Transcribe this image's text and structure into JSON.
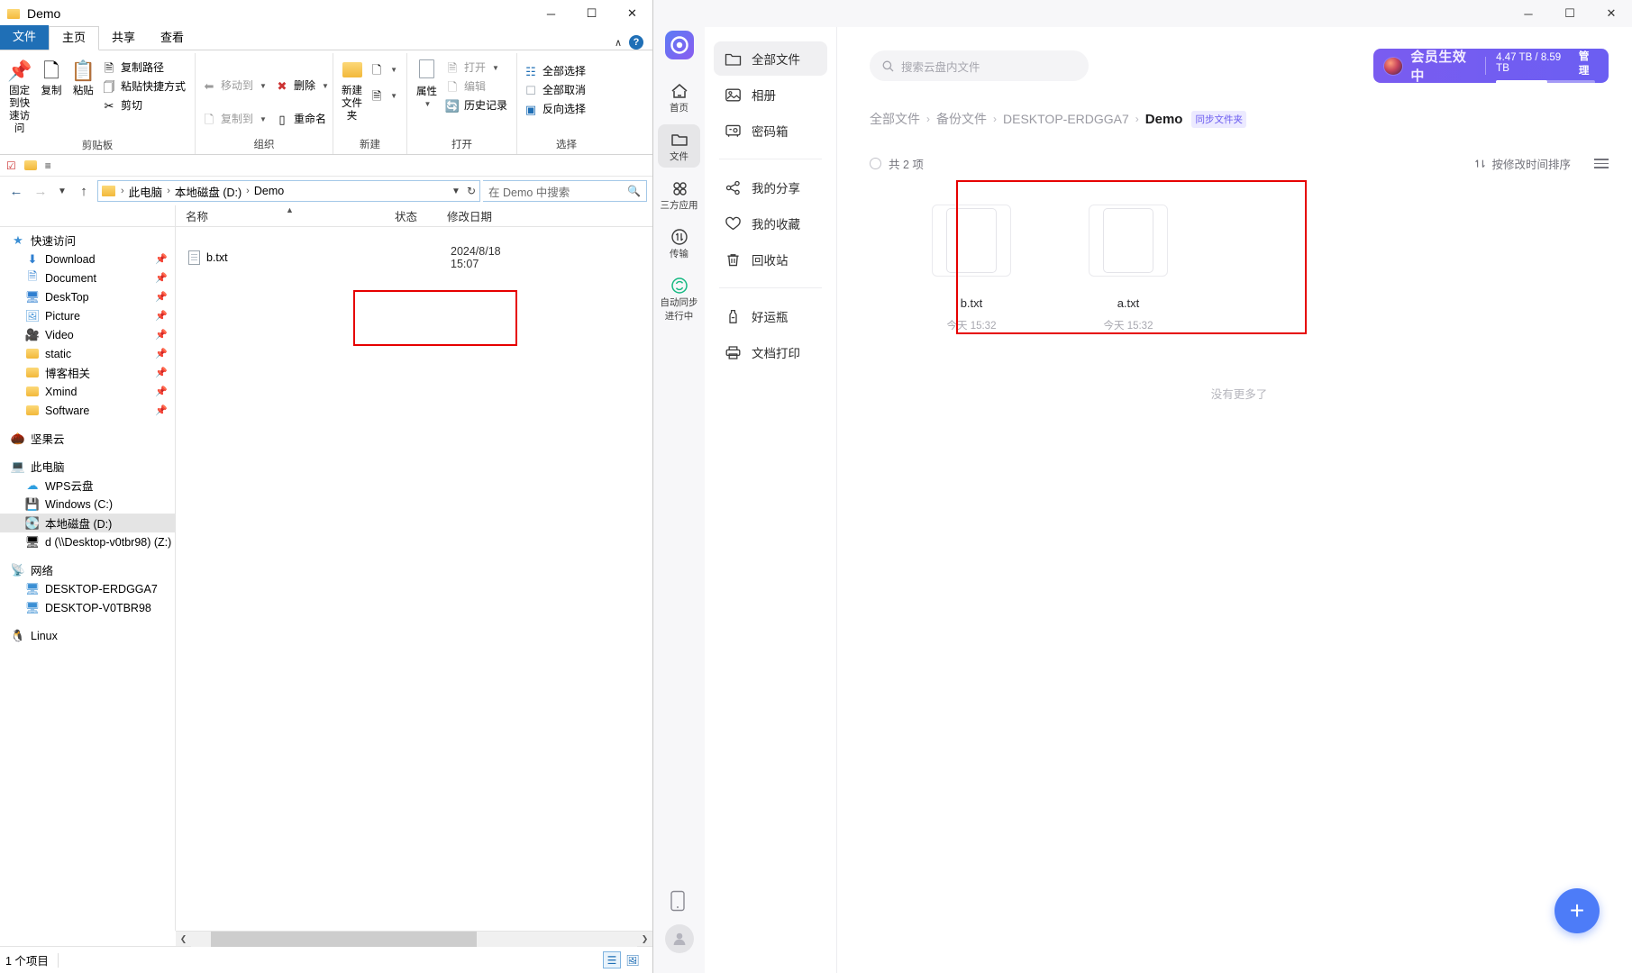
{
  "explorer": {
    "window_title": "Demo",
    "window_controls": {
      "minimize": "─",
      "maximize": "☐",
      "close": "✕"
    },
    "ribbon_tabs": [
      {
        "label": "文件"
      },
      {
        "label": "主页"
      },
      {
        "label": "共享"
      },
      {
        "label": "查看"
      }
    ],
    "ribbon_help": {
      "collapse": "∧",
      "help": "?"
    },
    "ribbon_groups": [
      {
        "label": "剪贴板",
        "big": [
          {
            "label_line1": "固定到快",
            "label_line2": "速访问",
            "icon": "pin-icon"
          },
          {
            "label_line1": "复制",
            "label_line2": "",
            "icon": "copy-icon"
          },
          {
            "label_line1": "粘贴",
            "label_line2": "",
            "icon": "paste-icon"
          }
        ],
        "small": [
          {
            "label": "复制路径",
            "icon": "copy-path-icon",
            "dim": false
          },
          {
            "label": "粘贴快捷方式",
            "icon": "paste-shortcut-icon",
            "dim": false
          },
          {
            "label": "剪切",
            "icon": "scissors-icon",
            "dim": false
          }
        ]
      },
      {
        "label": "组织",
        "small": [
          {
            "label": "移动到",
            "icon": "move-to-icon",
            "dim": true,
            "caret": true
          },
          {
            "label": "复制到",
            "icon": "copy-to-icon",
            "dim": true,
            "caret": true
          },
          {
            "label": "删除",
            "icon": "delete-icon",
            "dim": false,
            "caret": true
          },
          {
            "label": "重命名",
            "icon": "rename-icon",
            "dim": false,
            "caret": false
          }
        ]
      },
      {
        "label": "新建",
        "big": [
          {
            "label_line1": "新建",
            "label_line2": "文件夹",
            "icon": "new-folder-icon"
          }
        ],
        "small": [
          {
            "label": "",
            "icon": "new-item-icon",
            "dim": false,
            "caret": true
          },
          {
            "label": "",
            "icon": "easy-access-icon",
            "dim": false,
            "caret": true
          }
        ]
      },
      {
        "label": "打开",
        "big": [
          {
            "label_line1": "属性",
            "label_line2": "",
            "icon": "properties-icon"
          }
        ],
        "small": [
          {
            "label": "打开",
            "icon": "open-icon",
            "dim": true,
            "caret": true
          },
          {
            "label": "编辑",
            "icon": "edit-icon",
            "dim": true,
            "caret": false
          },
          {
            "label": "历史记录",
            "icon": "history-icon",
            "dim": false,
            "caret": false
          }
        ]
      },
      {
        "label": "选择",
        "small": [
          {
            "label": "全部选择",
            "icon": "select-all-icon",
            "dim": false
          },
          {
            "label": "全部取消",
            "icon": "select-none-icon",
            "dim": false
          },
          {
            "label": "反向选择",
            "icon": "invert-selection-icon",
            "dim": false
          }
        ]
      }
    ],
    "address": {
      "crumbs": [
        "此电脑",
        "本地磁盘 (D:)",
        "Demo"
      ],
      "search_placeholder": "在 Demo 中搜索"
    },
    "columns": [
      {
        "label": "名称"
      },
      {
        "label": "状态"
      },
      {
        "label": "修改日期"
      }
    ],
    "tree": [
      {
        "label": "快速访问",
        "level": 1,
        "icon": "star-icon",
        "pin": false
      },
      {
        "label": "Download",
        "level": 2,
        "icon": "download-icon",
        "pin": true
      },
      {
        "label": "Document",
        "level": 2,
        "icon": "document-icon",
        "pin": true
      },
      {
        "label": "DeskTop",
        "level": 2,
        "icon": "desktop-icon",
        "pin": true
      },
      {
        "label": "Picture",
        "level": 2,
        "icon": "picture-icon",
        "pin": true
      },
      {
        "label": "Video",
        "level": 2,
        "icon": "video-icon",
        "pin": true
      },
      {
        "label": "static",
        "level": 2,
        "icon": "folder-icon",
        "pin": true
      },
      {
        "label": "博客相关",
        "level": 2,
        "icon": "folder-icon",
        "pin": true
      },
      {
        "label": "Xmind",
        "level": 2,
        "icon": "folder-icon",
        "pin": true
      },
      {
        "label": "Software",
        "level": 2,
        "icon": "folder-icon",
        "pin": true
      },
      {
        "label": "坚果云",
        "level": 1,
        "icon": "nutstore-icon",
        "pin": false,
        "gap_before": true
      },
      {
        "label": "此电脑",
        "level": 1,
        "icon": "this-pc-icon",
        "pin": false,
        "gap_before": true
      },
      {
        "label": "WPS云盘",
        "level": 2,
        "icon": "wps-cloud-icon",
        "pin": false
      },
      {
        "label": "Windows (C:)",
        "level": 2,
        "icon": "drive-icon",
        "pin": false
      },
      {
        "label": "本地磁盘 (D:)",
        "level": 2,
        "icon": "drive-icon",
        "pin": false,
        "selected": true
      },
      {
        "label": "d (\\\\Desktop-v0tbr98) (Z:)",
        "level": 2,
        "icon": "network-drive-icon",
        "pin": false
      },
      {
        "label": "网络",
        "level": 1,
        "icon": "network-icon",
        "pin": false,
        "gap_before": true
      },
      {
        "label": "DESKTOP-ERDGGA7",
        "level": 2,
        "icon": "computer-icon",
        "pin": false
      },
      {
        "label": "DESKTOP-V0TBR98",
        "level": 2,
        "icon": "computer-icon",
        "pin": false
      },
      {
        "label": "Linux",
        "level": 1,
        "icon": "linux-icon",
        "pin": false,
        "gap_before": true
      }
    ],
    "files": [
      {
        "name": "b.txt",
        "status": "",
        "modified": "2024/8/18 15:07"
      }
    ],
    "status_text": "1 个项目"
  },
  "cloud": {
    "window_controls": {
      "minimize": "─",
      "maximize": "☐",
      "close": "✕"
    },
    "rail": [
      {
        "label": "首页",
        "icon": "home-icon",
        "active": false
      },
      {
        "label": "文件",
        "icon": "folder-icon",
        "active": true
      },
      {
        "label": "三方应用",
        "icon": "apps-icon",
        "active": false
      },
      {
        "label": "传输",
        "icon": "transfer-icon",
        "active": false
      },
      {
        "label_line1": "自动同步",
        "label_line2": "进行中",
        "label": "自动同步",
        "icon": "sync-icon",
        "active": false
      }
    ],
    "nav": [
      {
        "label": "全部文件",
        "icon": "folder-icon",
        "active": true
      },
      {
        "label": "相册",
        "icon": "album-icon",
        "active": false
      },
      {
        "label": "密码箱",
        "icon": "safe-box-icon",
        "active": false
      },
      {
        "divider": true
      },
      {
        "label": "我的分享",
        "icon": "share-icon",
        "active": false
      },
      {
        "label": "我的收藏",
        "icon": "heart-icon",
        "active": false
      },
      {
        "label": "回收站",
        "icon": "trash-icon",
        "active": false
      },
      {
        "divider": true
      },
      {
        "label": "好运瓶",
        "icon": "bottle-icon",
        "active": false
      },
      {
        "label": "文档打印",
        "icon": "printer-icon",
        "active": false
      }
    ],
    "search_placeholder": "搜索云盘内文件",
    "vip": {
      "label": "会员生效中",
      "quota": "4.47 TB / 8.59 TB",
      "manage": "管理",
      "used_percent": 52
    },
    "breadcrumb": {
      "items": [
        "全部文件",
        "备份文件",
        "DESKTOP-ERDGGA7"
      ],
      "current": "Demo",
      "tag": "同步文件夹"
    },
    "toolbar": {
      "count_label": "共 2 项",
      "sort_label": "按修改时间排序"
    },
    "files": [
      {
        "name": "b.txt",
        "date": "今天 15:32"
      },
      {
        "name": "a.txt",
        "date": "今天 15:32"
      }
    ],
    "no_more": "没有更多了",
    "fab_label": "+"
  },
  "colors": {
    "accent_blue": "#1f6fb6",
    "vip_purple": "#6b5ef2",
    "highlight_red": "#e60000",
    "fab_blue": "#4d7cf8"
  }
}
